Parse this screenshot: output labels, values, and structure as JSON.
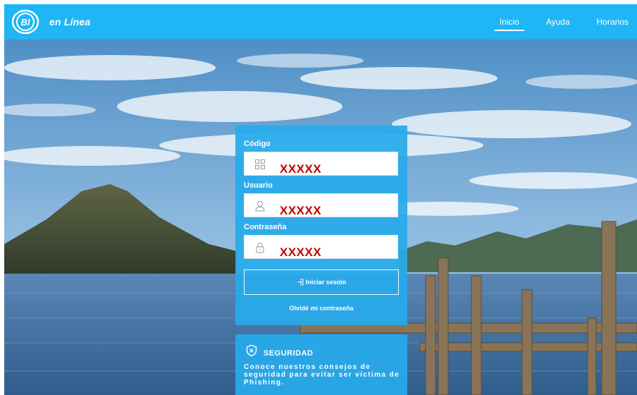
{
  "header": {
    "logo_text": "en Línea",
    "logo_mark": "BI",
    "nav": [
      "Inicio",
      "Ayuda",
      "Horarios"
    ]
  },
  "login": {
    "codigo_label": "Código",
    "codigo_value": "XXXXX",
    "usuario_label": "Usuario",
    "usuario_value": "XXXXX",
    "password_label": "Contraseña",
    "password_value": "XXXXX",
    "submit_label": "Iniciar sesión",
    "forgot_label": "Olvidé mi contraseña"
  },
  "security": {
    "title": "SEGURIDAD",
    "text": "Conoce nuestros consejos de seguridad para evitar ser víctima de Phishing."
  },
  "colors": {
    "brand": "#1fb6f5",
    "card": "#28aaeb",
    "redacted": "#c00000"
  }
}
